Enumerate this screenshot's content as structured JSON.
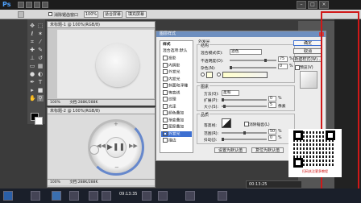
{
  "app": {
    "logo": "Ps"
  },
  "options_bar": {
    "checkbox_label": "消除锯齿窗口",
    "zoom_value": "100%",
    "fit_screen_button": "适合屏幕",
    "fill_screen_button": "填充屏幕"
  },
  "doc1": {
    "tab": "未标题-1 @ 100%(RGB/8)",
    "zoom": "100%",
    "size": "文档:288K/288K"
  },
  "doc2": {
    "tab": "未标题-2 @ 100%(RGB/8)",
    "zoom": "100%",
    "size": "文档:288K/288K"
  },
  "dialog": {
    "title": "图层样式",
    "styles_header": "样式",
    "blend_options": "混合选项:默认",
    "effects": [
      {
        "label": "投影",
        "checked": false
      },
      {
        "label": "内阴影",
        "checked": false
      },
      {
        "label": "外发光",
        "checked": false
      },
      {
        "label": "内发光",
        "checked": false
      },
      {
        "label": "斜面和浮雕",
        "checked": false
      },
      {
        "label": "等高线",
        "checked": false
      },
      {
        "label": "纹理",
        "checked": false
      },
      {
        "label": "光泽",
        "checked": false
      },
      {
        "label": "颜色叠加",
        "checked": false
      },
      {
        "label": "渐变叠加",
        "checked": false
      },
      {
        "label": "图案叠加",
        "checked": false
      },
      {
        "label": "外发光",
        "checked": true,
        "selected": true
      },
      {
        "label": "描边",
        "checked": false
      }
    ],
    "section_title": "外发光",
    "structure": {
      "title": "结构",
      "blend_mode_label": "混合模式(E):",
      "blend_mode_value": "滤色",
      "opacity_label": "不透明度(O):",
      "opacity_value": "75",
      "noise_label": "杂色(N):",
      "noise_value": "0",
      "percent": "%"
    },
    "elements": {
      "title": "图素",
      "method_label": "方法(Q):",
      "method_value": "柔和",
      "spread_label": "扩展(P):",
      "spread_value": "0",
      "size_label": "大小(S):",
      "size_value": "5",
      "px": "像素",
      "percent": "%"
    },
    "quality": {
      "title": "品质",
      "contour_label": "等高线:",
      "antialias_label": "消除锯齿(L)",
      "range_label": "范围(R):",
      "range_value": "50",
      "jitter_label": "抖动(J):",
      "jitter_value": "0",
      "percent": "%"
    },
    "default_button": "设置为默认值",
    "reset_button": "复位为默认值",
    "ok_button": "确定",
    "cancel_button": "取消",
    "new_style_button": "新建样式(W)...",
    "preview_label": "预览(V)"
  },
  "qr_caption": "扫码关注更多教程",
  "player_bar_time": "00:13:25",
  "taskbar": {
    "clock": "09:13:35"
  },
  "colors": {
    "dialog_title": "#6e8fbf",
    "selection": "#3d6fd1",
    "frame_red": "#d01818",
    "ring_blue": "#6688cc"
  }
}
